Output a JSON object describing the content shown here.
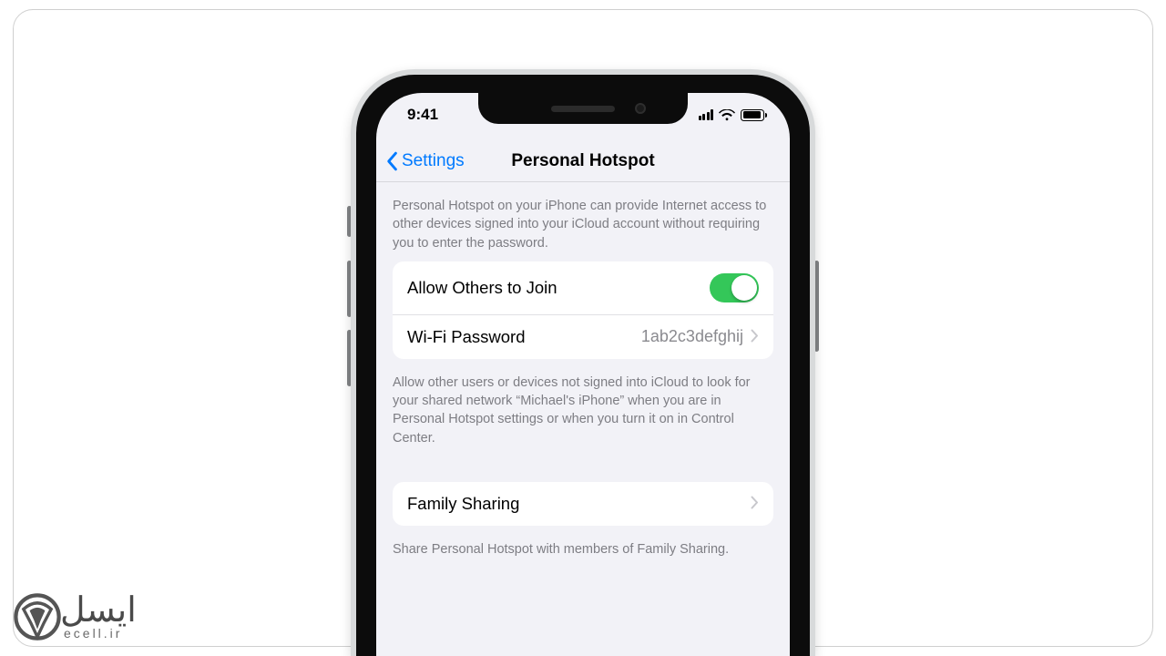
{
  "status": {
    "time": "9:41"
  },
  "nav": {
    "back_label": "Settings",
    "title": "Personal Hotspot"
  },
  "intro_text": "Personal Hotspot on your iPhone can provide Internet access to other devices signed into your iCloud account without requiring you to enter the password.",
  "group1": {
    "allow_label": "Allow Others to Join",
    "allow_on": true,
    "password_label": "Wi-Fi Password",
    "password_value": "1ab2c3defghij"
  },
  "allow_desc": "Allow other users or devices not signed into iCloud to look for your shared network “Michael's iPhone” when you are in Personal Hotspot settings or when you turn it on in Control Center.",
  "group2": {
    "family_label": "Family Sharing"
  },
  "family_desc": "Share Personal Hotspot with members of Family Sharing.",
  "watermark": {
    "brand_top": "ایسل",
    "brand_bottom": "ecell.ir"
  },
  "colors": {
    "ios_blue": "#007aff",
    "switch_green": "#34c759",
    "bg": "#f2f2f7"
  }
}
